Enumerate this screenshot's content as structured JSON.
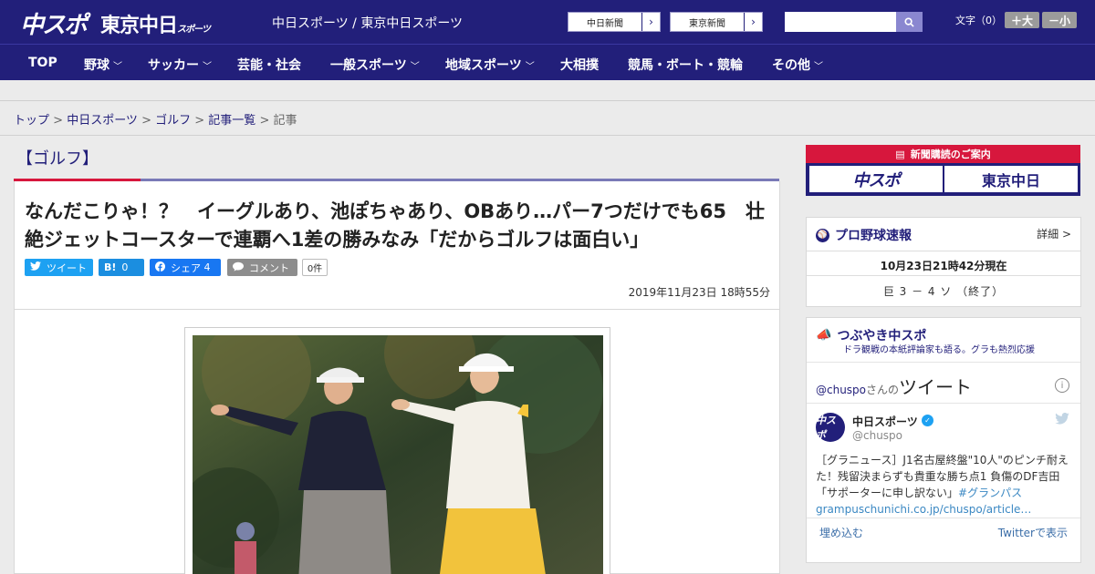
{
  "header": {
    "logo_chuspo": "中スポ",
    "logo_tokyo": "東京中日",
    "logo_tokyo_small": "スポーツ",
    "site_names": "中日スポーツ / 東京中日スポーツ",
    "ext_links": [
      "中日新聞",
      "東京新聞"
    ],
    "font_label": "文字（0）",
    "font_up": "＋大",
    "font_down": "－小",
    "search_placeholder": ""
  },
  "nav": {
    "items": [
      {
        "label": "TOP",
        "dropdown": false
      },
      {
        "label": "野球",
        "dropdown": true
      },
      {
        "label": "サッカー",
        "dropdown": true
      },
      {
        "label": "芸能・社会",
        "dropdown": false
      },
      {
        "label": "一般スポーツ",
        "dropdown": true
      },
      {
        "label": "地域スポーツ",
        "dropdown": true
      },
      {
        "label": "大相撲",
        "dropdown": false
      },
      {
        "label": "競馬・ボート・競輪",
        "dropdown": false
      },
      {
        "label": "その他",
        "dropdown": true
      }
    ]
  },
  "breadcrumb": {
    "items": [
      "トップ",
      "中日スポーツ",
      "ゴルフ",
      "記事一覧"
    ],
    "current": "記事",
    "sep": " > "
  },
  "article": {
    "category": "【ゴルフ】",
    "headline": "なんだこりゃ！？　イーグルあり、池ぽちゃあり、OBあり…パー7つだけでも65　壮絶ジェットコースターで連覇へ1差の勝みなみ「だからゴルフは面白い」",
    "share": {
      "tweet": "ツイート",
      "hatena_icon": "B!",
      "hatena_count": "0",
      "facebook": "シェア",
      "facebook_count": "4",
      "comment": "コメント",
      "comment_count": "0件"
    },
    "date": "2019年11月23日 18時55分"
  },
  "sidebar": {
    "subscribe": {
      "heading": "新聞購読のご案内",
      "logos": [
        "中スポ",
        "東京中日"
      ]
    },
    "baseball": {
      "title": "プロ野球速報",
      "detail": "詳細 >",
      "time": "10月23日21時42分現在",
      "score": "巨 3 － 4 ソ （終了）"
    },
    "tweets": {
      "title": "つぶやき中スポ",
      "subtitle": "ドラ観戦の本紙評論家も語る。グラも熱烈応援",
      "handle": "@chuspo",
      "handle_suffix": "さんの",
      "heading": "ツイート",
      "avatar": "中スポ",
      "user_name": "中日スポーツ",
      "screen_name": "@chuspo",
      "text": "［グラニュース］J1名古屋終盤\"10人\"のピンチ耐えた！残留決まらずも貴重な勝ち点1 負傷のDF吉田「サポーターに申し訳ない」",
      "hashtag": "#グランパス",
      "link": "grampuschunichi.co.jp/chuspo/article…",
      "embed": "埋め込む",
      "view": "Twitterで表示"
    }
  },
  "colors": {
    "brand": "#221f7a",
    "accent_red": "#d7173d",
    "twitter": "#1da1f2",
    "facebook": "#1877f2"
  }
}
